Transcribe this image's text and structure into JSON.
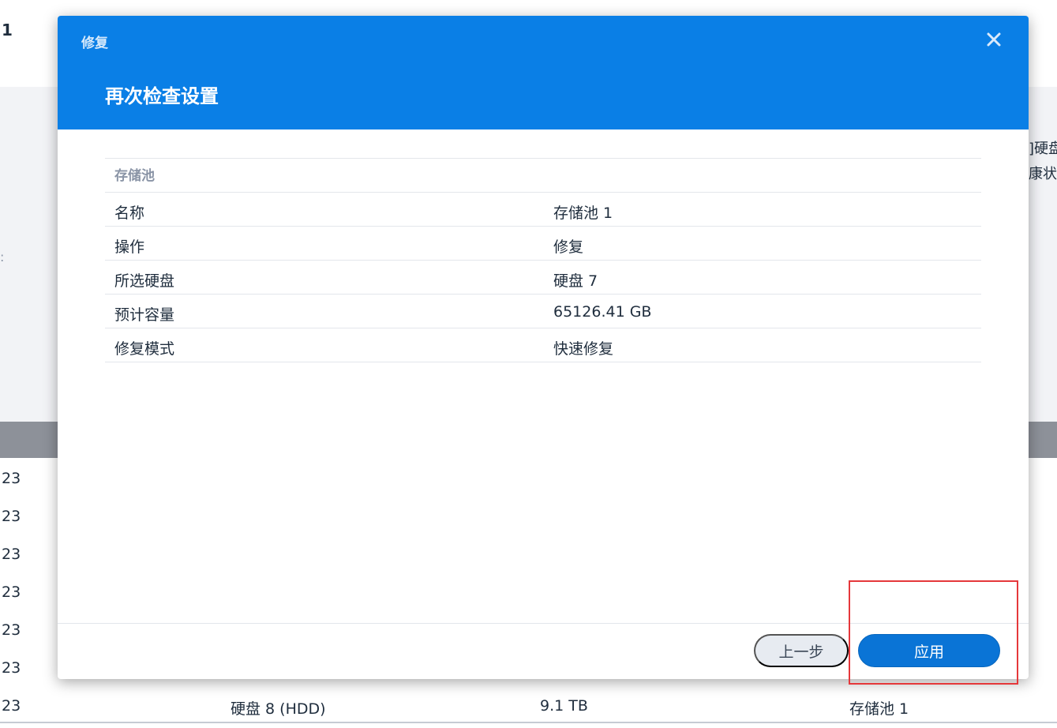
{
  "background": {
    "top_number": "1",
    "side_text": [
      "]硬盘",
      "康状"
    ],
    "left_mark": ":",
    "rows": [
      {
        "c0": "23",
        "c1": "",
        "c2": "",
        "c3": ""
      },
      {
        "c0": "23",
        "c1": "",
        "c2": "",
        "c3": ""
      },
      {
        "c0": "23",
        "c1": "",
        "c2": "",
        "c3": ""
      },
      {
        "c0": "23",
        "c1": "",
        "c2": "",
        "c3": ""
      },
      {
        "c0": "23",
        "c1": "",
        "c2": "",
        "c3": ""
      },
      {
        "c0": "23",
        "c1": "",
        "c2": "",
        "c3": ""
      },
      {
        "c0": "23",
        "c1": "硬盘 8 (HDD)",
        "c2": "9.1 TB",
        "c3": "存储池 1"
      }
    ]
  },
  "dialog": {
    "title": "修复",
    "step_title": "再次检查设置",
    "close_icon": "close-icon",
    "summary": {
      "section_header": "存储池",
      "rows": [
        {
          "key": "名称",
          "value": "存储池 1"
        },
        {
          "key": "操作",
          "value": "修复"
        },
        {
          "key": "所选硬盘",
          "value": "硬盘 7"
        },
        {
          "key": "预计容量",
          "value": "65126.41 GB"
        },
        {
          "key": "修复模式",
          "value": "快速修复"
        }
      ]
    },
    "buttons": {
      "prev": "上一步",
      "apply": "应用"
    }
  },
  "colors": {
    "header_blue": "#0a7fe6",
    "apply_blue": "#0a74d6",
    "highlight_red": "#e5383b"
  }
}
